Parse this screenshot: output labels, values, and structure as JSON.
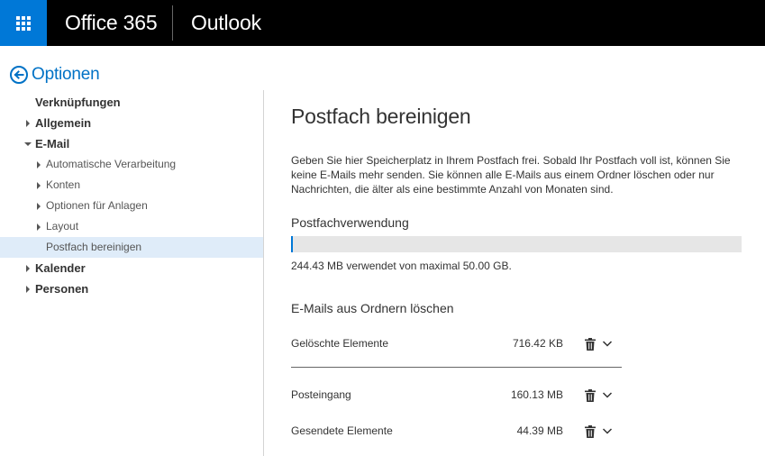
{
  "header": {
    "brand": "Office 365",
    "app": "Outlook"
  },
  "back": {
    "label": "Optionen"
  },
  "nav": {
    "items": [
      {
        "label": "Verknüpfungen",
        "level": 0,
        "caret": "none"
      },
      {
        "label": "Allgemein",
        "level": 0,
        "caret": "right"
      },
      {
        "label": "E-Mail",
        "level": 0,
        "caret": "down"
      },
      {
        "label": "Automatische Verarbeitung",
        "level": 1,
        "caret": "right"
      },
      {
        "label": "Konten",
        "level": 1,
        "caret": "right"
      },
      {
        "label": "Optionen für Anlagen",
        "level": 1,
        "caret": "right"
      },
      {
        "label": "Layout",
        "level": 1,
        "caret": "right"
      },
      {
        "label": "Postfach bereinigen",
        "level": 1,
        "caret": "none",
        "selected": true
      },
      {
        "label": "Kalender",
        "level": 0,
        "caret": "right"
      },
      {
        "label": "Personen",
        "level": 0,
        "caret": "right"
      }
    ]
  },
  "main": {
    "title": "Postfach bereinigen",
    "description": "Geben Sie hier Speicherplatz in Ihrem Postfach frei. Sobald Ihr Postfach voll ist, können Sie keine E-Mails mehr senden. Sie können alle E-Mails aus einem Ordner löschen oder nur Nachrichten, die älter als eine bestimmte Anzahl von Monaten sind.",
    "usage_title": "Postfachverwendung",
    "usage_fraction": 0.0049,
    "usage_text": "244.43 MB verwendet von maximal 50.00 GB.",
    "folders_title": "E-Mails aus Ordnern löschen",
    "folders": [
      {
        "name": "Gelöschte Elemente",
        "size": "716.42 KB"
      },
      {
        "name": "Posteingang",
        "size": "160.13 MB"
      },
      {
        "name": "Gesendete Elemente",
        "size": "44.39 MB"
      }
    ]
  },
  "colors": {
    "accent": "#0072c6",
    "waffle": "#0078d7",
    "topbar": "#000000",
    "selected": "#dfecf9"
  }
}
